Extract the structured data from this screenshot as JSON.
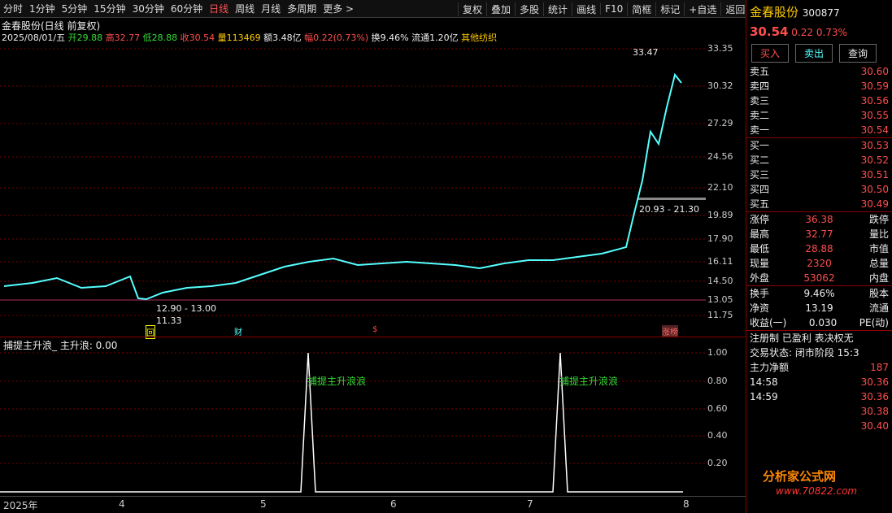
{
  "toolbar": {
    "left": [
      "分时",
      "1分钟",
      "5分钟",
      "15分钟",
      "30分钟",
      "60分钟",
      "日线",
      "周线",
      "月线",
      "多周期",
      "更多 >"
    ],
    "right": [
      "复权",
      "叠加",
      "多股",
      "统计",
      "画线",
      "F10",
      "简框",
      "标记",
      "+自选",
      "返回"
    ]
  },
  "chart": {
    "title": "金春股份(日线 前复权)",
    "date": "2025/08/01/五",
    "open": "开29.88",
    "high": "高32.77",
    "low": "低28.88",
    "close": "收30.54",
    "vol": "量113469",
    "amt": "额3.48亿",
    "amp": "幅0.22(0.73%)",
    "turn": "换9.46%",
    "float": "流通1.20亿",
    "industry": "其他纺织",
    "yticks": [
      "33.35",
      "30.32",
      "27.29",
      "24.56",
      "22.10",
      "19.89",
      "17.90",
      "16.11",
      "14.50",
      "13.05",
      "11.75"
    ],
    "ann_high": "33.47",
    "ann_mid": "20.93 - 21.30",
    "ann_low1": "12.90 - 13.00",
    "ann_low2": "11.33",
    "markers": [
      "回",
      "财",
      "$",
      "涨榜"
    ]
  },
  "indicator": {
    "title": "捕提主升浪_ 主升浪: 0.00",
    "label": "捕提主升浪浪",
    "yticks": [
      "1.00",
      "0.80",
      "0.60",
      "0.40",
      "0.20"
    ]
  },
  "xaxis": {
    "labels": [
      "2025年",
      "4",
      "5",
      "6",
      "7",
      "8"
    ]
  },
  "stock": {
    "name": "金春股份",
    "code": "300877",
    "price": "30.54",
    "change": "0.22",
    "pct": "0.73%",
    "buy": "买入",
    "sell": "卖出",
    "query": "查询"
  },
  "asks": [
    [
      "卖五",
      "30.60"
    ],
    [
      "卖四",
      "30.59"
    ],
    [
      "卖三",
      "30.56"
    ],
    [
      "卖二",
      "30.55"
    ],
    [
      "卖一",
      "30.54"
    ]
  ],
  "bids": [
    [
      "买一",
      "30.53"
    ],
    [
      "买二",
      "30.52"
    ],
    [
      "买三",
      "30.51"
    ],
    [
      "买四",
      "30.50"
    ],
    [
      "买五",
      "30.49"
    ]
  ],
  "stats": [
    [
      "涨停",
      "36.38",
      "跌停"
    ],
    [
      "最高",
      "32.77",
      "量比"
    ],
    [
      "最低",
      "28.88",
      "市值"
    ],
    [
      "现量",
      "2320",
      "总量"
    ],
    [
      "外盘",
      "53062",
      "内盘"
    ]
  ],
  "stats2": [
    [
      "换手",
      "9.46%",
      "股本"
    ],
    [
      "净资",
      "13.19",
      "流通"
    ],
    [
      "收益(一)",
      "0.030",
      "PE(动)"
    ]
  ],
  "info": [
    "注册制 已盈利 表决权无",
    "交易状态: 闭市阶段 15:3"
  ],
  "flow": {
    "label": "主力净额",
    "value": "187"
  },
  "ticks": [
    [
      "14:58",
      "30.36"
    ],
    [
      "14:59",
      "30.36"
    ],
    [
      "",
      "30.38"
    ],
    [
      "",
      "30.40"
    ]
  ],
  "watermark": {
    "name": "分析家公式网",
    "url": "www.70822.com"
  }
}
